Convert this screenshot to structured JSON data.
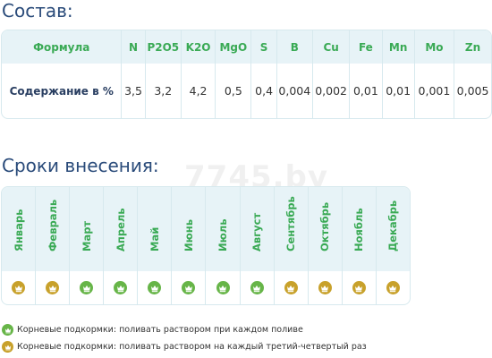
{
  "composition": {
    "title": "Состав:",
    "headers": [
      "Формула",
      "N",
      "P2O5",
      "K2O",
      "MgO",
      "S",
      "B",
      "Cu",
      "Fe",
      "Mn",
      "Mo",
      "Zn"
    ],
    "row": [
      "Содержание в %",
      "3,5",
      "3,2",
      "4,2",
      "0,5",
      "0,4",
      "0,004",
      "0,002",
      "0,01",
      "0,01",
      "0,001",
      "0,005"
    ]
  },
  "schedule": {
    "title": "Сроки внесения:",
    "months": [
      "Январь",
      "Февраль",
      "Март",
      "Апрель",
      "Май",
      "Июнь",
      "Июль",
      "Август",
      "Сентябрь",
      "Октябрь",
      "Ноябль",
      "Декабрь"
    ],
    "marks": [
      "third-fourth",
      "third-fourth",
      "each",
      "each",
      "each",
      "each",
      "each",
      "each",
      "third-fourth",
      "third-fourth",
      "third-fourth",
      "third-fourth"
    ]
  },
  "legend": [
    {
      "type": "each",
      "text": "Корневые подкормки: поливать раствором при каждом поливе"
    },
    {
      "type": "third-fourth",
      "text": "Корневые подкормки: поливать раствором на каждый третий-четвертый раз"
    }
  ],
  "colors": {
    "each": "#67b548",
    "third-fourth": "#c8a12b"
  },
  "icons": {
    "each": "crown-icon",
    "third-fourth": "crown-icon"
  },
  "watermark": "7745.by"
}
